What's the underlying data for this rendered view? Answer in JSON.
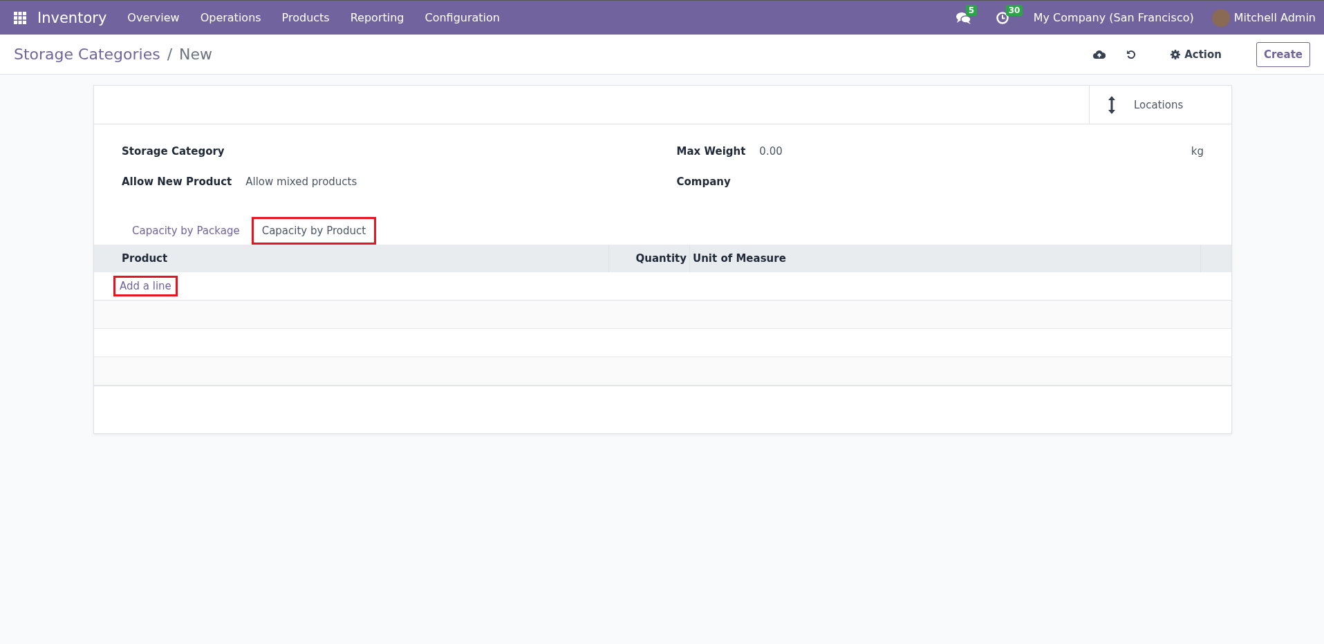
{
  "navbar": {
    "app_name": "Inventory",
    "menu": [
      "Overview",
      "Operations",
      "Products",
      "Reporting",
      "Configuration"
    ],
    "messages_count": "5",
    "activities_count": "30",
    "company": "My Company (San Francisco)",
    "user": "Mitchell Admin"
  },
  "breadcrumb": {
    "parent": "Storage Categories",
    "separator": "/",
    "current": "New"
  },
  "actions": {
    "action_label": "Action",
    "create_label": "Create"
  },
  "smart_button": {
    "label": "Locations"
  },
  "fields_left": [
    {
      "label": "Storage Category"
    },
    {
      "label": "Allow New Product",
      "value": "Allow mixed products"
    }
  ],
  "fields_right": [
    {
      "label": "Max Weight",
      "value": "0.00",
      "unit": "kg"
    },
    {
      "label": "Company"
    }
  ],
  "tabs": [
    {
      "label": "Capacity by Package",
      "selected": false,
      "highlighted": false
    },
    {
      "label": "Capacity by Product",
      "selected": true,
      "highlighted": true
    }
  ],
  "table": {
    "columns": [
      "Product",
      "Quantity",
      "Unit of Measure"
    ],
    "add_line": {
      "label": "Add a line",
      "highlighted": true
    }
  }
}
